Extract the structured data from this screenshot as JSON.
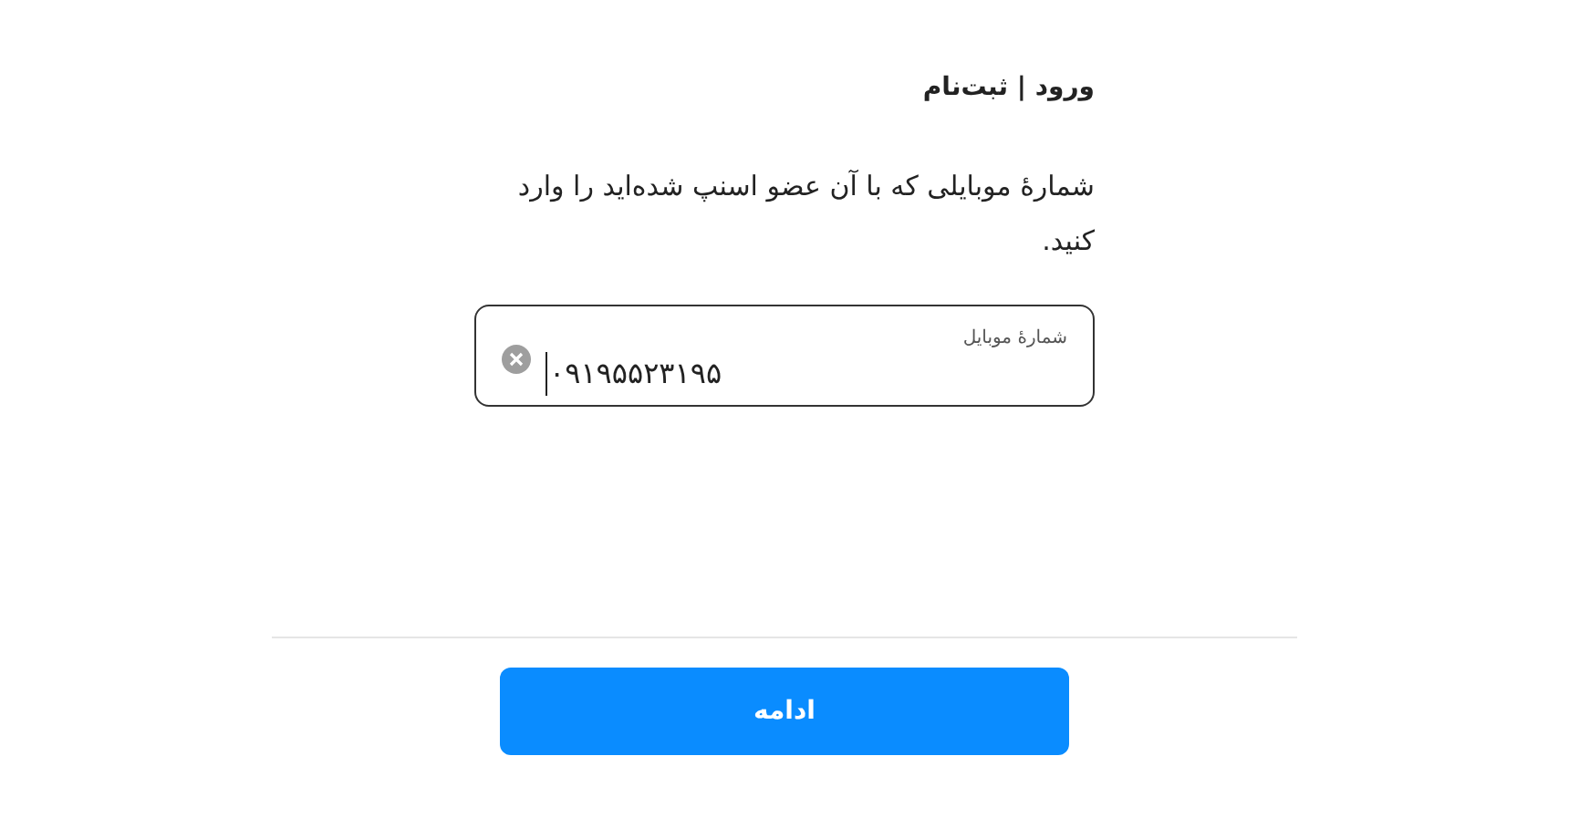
{
  "title": "ورود | ثبت‌نام",
  "instruction": "شمارهٔ موبایلی که با آن عضو اسنپ شده‌اید را وارد کنید.",
  "phone_field": {
    "label": "شمارهٔ موبایل",
    "value": "۰۹۱۹۵۵۲۳۱۹۵"
  },
  "continue_button": "ادامه"
}
